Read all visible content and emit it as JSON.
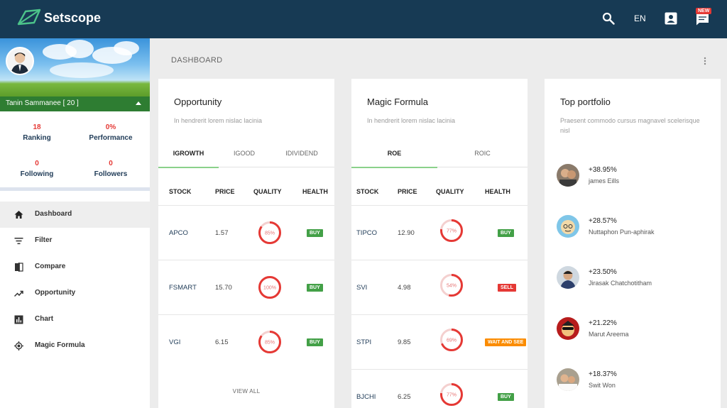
{
  "app": {
    "brand": "Setscope",
    "lang": "EN",
    "notification_badge": "NEW"
  },
  "colors": {
    "topbar": "#173a54",
    "accent_red": "#e53935",
    "buy": "#43a047",
    "sell": "#e53935",
    "wait": "#fb8c00",
    "tab_underline": "#8bd18b"
  },
  "profile": {
    "name": "Tanin Sammanee [ 20 ]",
    "stats": [
      {
        "value": "18",
        "label": "Ranking"
      },
      {
        "value": "0%",
        "label": "Performance"
      },
      {
        "value": "0",
        "label": "Following"
      },
      {
        "value": "0",
        "label": "Followers"
      }
    ]
  },
  "nav": [
    {
      "label": "Dashboard",
      "icon": "home-icon",
      "active": true
    },
    {
      "label": "Filter",
      "icon": "filter-icon",
      "active": false
    },
    {
      "label": "Compare",
      "icon": "compare-icon",
      "active": false
    },
    {
      "label": "Opportunity",
      "icon": "trending-up-icon",
      "active": false
    },
    {
      "label": "Chart",
      "icon": "bar-chart-icon",
      "active": false
    },
    {
      "label": "Magic Formula",
      "icon": "target-icon",
      "active": false
    }
  ],
  "page": {
    "title": "DASHBOARD"
  },
  "opportunity": {
    "title": "Opportunity",
    "subtitle": "In hendrerit lorem nislac lacinia",
    "tabs": [
      "IGROWTH",
      "IGOOD",
      "IDIVIDEND"
    ],
    "headers": [
      "STOCK",
      "PRICE",
      "QUALITY",
      "HEALTH"
    ],
    "rows": [
      {
        "stock": "APCO",
        "price": "1.57",
        "quality": "85%",
        "quality_value": 85,
        "health": "BUY",
        "health_type": "buy"
      },
      {
        "stock": "FSMART",
        "price": "15.70",
        "quality": "100%",
        "quality_value": 100,
        "health": "BUY",
        "health_type": "buy"
      },
      {
        "stock": "VGI",
        "price": "6.15",
        "quality": "85%",
        "quality_value": 85,
        "health": "BUY",
        "health_type": "buy"
      }
    ],
    "view_all": "VIEW ALL"
  },
  "magic": {
    "title": "Magic Formula",
    "subtitle": "In hendrerit lorem nislac lacinia",
    "tabs": [
      "ROE",
      "ROIC"
    ],
    "headers": [
      "STOCK",
      "PRICE",
      "QUALITY",
      "HEALTH"
    ],
    "rows": [
      {
        "stock": "TIPCO",
        "price": "12.90",
        "quality": "77%",
        "quality_value": 77,
        "health": "BUY",
        "health_type": "buy"
      },
      {
        "stock": "SVI",
        "price": "4.98",
        "quality": "54%",
        "quality_value": 54,
        "health": "SELL",
        "health_type": "sell"
      },
      {
        "stock": "STPI",
        "price": "9.85",
        "quality": "69%",
        "quality_value": 69,
        "health": "WAIT AND SEE",
        "health_type": "wait"
      },
      {
        "stock": "BJCHI",
        "price": "6.25",
        "quality": "77%",
        "quality_value": 77,
        "health": "BUY",
        "health_type": "buy"
      }
    ]
  },
  "portfolio": {
    "title": "Top portfolio",
    "subtitle": "Praesent commodo cursus magnavel scelerisque nisl",
    "items": [
      {
        "pct": "+38.95%",
        "name": "james Eills"
      },
      {
        "pct": "+28.57%",
        "name": "Nuttaphon Pun-aphirak"
      },
      {
        "pct": "+23.50%",
        "name": "Jirasak Chatchotitham"
      },
      {
        "pct": "+21.22%",
        "name": "Marut Areema"
      },
      {
        "pct": "+18.37%",
        "name": "Swit Won"
      }
    ]
  }
}
